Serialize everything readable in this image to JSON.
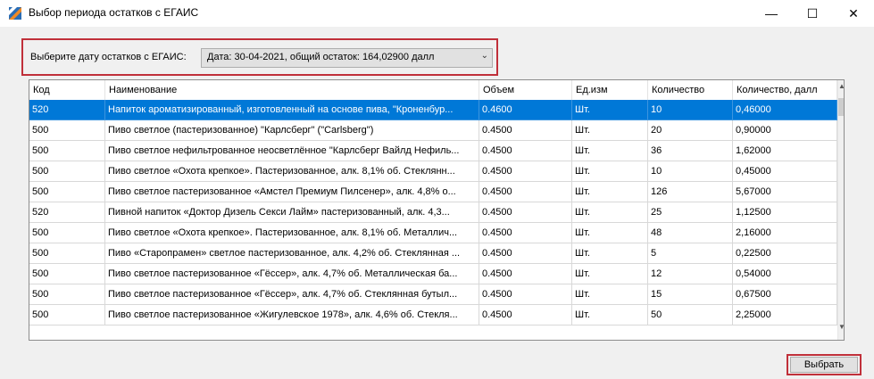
{
  "window": {
    "title": "Выбор периода остатков с ЕГАИС",
    "min_glyph": "—",
    "max_glyph": "☐",
    "close_glyph": "✕"
  },
  "date_picker": {
    "label": "Выберите дату остатков с ЕГАИС:",
    "selected": "Дата: 30-04-2021, общий остаток: 164,02900 далл",
    "arrow_glyph": "⌄"
  },
  "table": {
    "headers": [
      "Код",
      "Наименование",
      "Объем",
      "Ед.изм",
      "Количество",
      "Количество, далл"
    ],
    "rows": [
      [
        "520",
        "Напиток ароматизированный, изготовленный на основе пива, \"Кроненбур...",
        "0.4600",
        "Шт.",
        "10",
        "0,46000"
      ],
      [
        "500",
        "Пиво светлое (пастеризованное) \"Карлсберг\" (\"Carlsberg\")",
        "0.4500",
        "Шт.",
        "20",
        "0,90000"
      ],
      [
        "500",
        "Пиво светлое нефильтрованное неосветлённое \"Карлсберг Вайлд Нефиль...",
        "0.4500",
        "Шт.",
        "36",
        "1,62000"
      ],
      [
        "500",
        "Пиво светлое «Охота крепкое». Пастеризованное, алк. 8,1% об. Стеклянн...",
        "0.4500",
        "Шт.",
        "10",
        "0,45000"
      ],
      [
        "500",
        "Пиво светлое пастеризованное «Амстел Премиум Пилсенер», алк. 4,8% о...",
        "0.4500",
        "Шт.",
        "126",
        "5,67000"
      ],
      [
        "520",
        "Пивной напиток «Доктор Дизель Секси Лайм» пастеризованный, алк. 4,3...",
        "0.4500",
        "Шт.",
        "25",
        "1,12500"
      ],
      [
        "500",
        "Пиво светлое «Охота крепкое». Пастеризованное, алк. 8,1% об. Металлич...",
        "0.4500",
        "Шт.",
        "48",
        "2,16000"
      ],
      [
        "500",
        "Пиво «Старопрамен» светлое пастеризованное, алк. 4,2% об. Стеклянная ...",
        "0.4500",
        "Шт.",
        "5",
        "0,22500"
      ],
      [
        "500",
        "Пиво светлое пастеризованное «Гёссер», алк. 4,7% об. Металлическая ба...",
        "0.4500",
        "Шт.",
        "12",
        "0,54000"
      ],
      [
        "500",
        "Пиво светлое пастеризованное «Гёссер», алк. 4,7% об. Стеклянная бутыл...",
        "0.4500",
        "Шт.",
        "15",
        "0,67500"
      ],
      [
        "500",
        "Пиво светлое пастеризованное «Жигулевское 1978», алк. 4,6% об. Стекля...",
        "0.4500",
        "Шт.",
        "50",
        "2,25000"
      ]
    ],
    "selected_row": 0,
    "scroll_up_glyph": "▲",
    "scroll_down_glyph": "▼"
  },
  "footer": {
    "select_label": "Выбрать"
  },
  "colors": {
    "highlight_border": "#c0303a",
    "selection": "#0078d7"
  }
}
